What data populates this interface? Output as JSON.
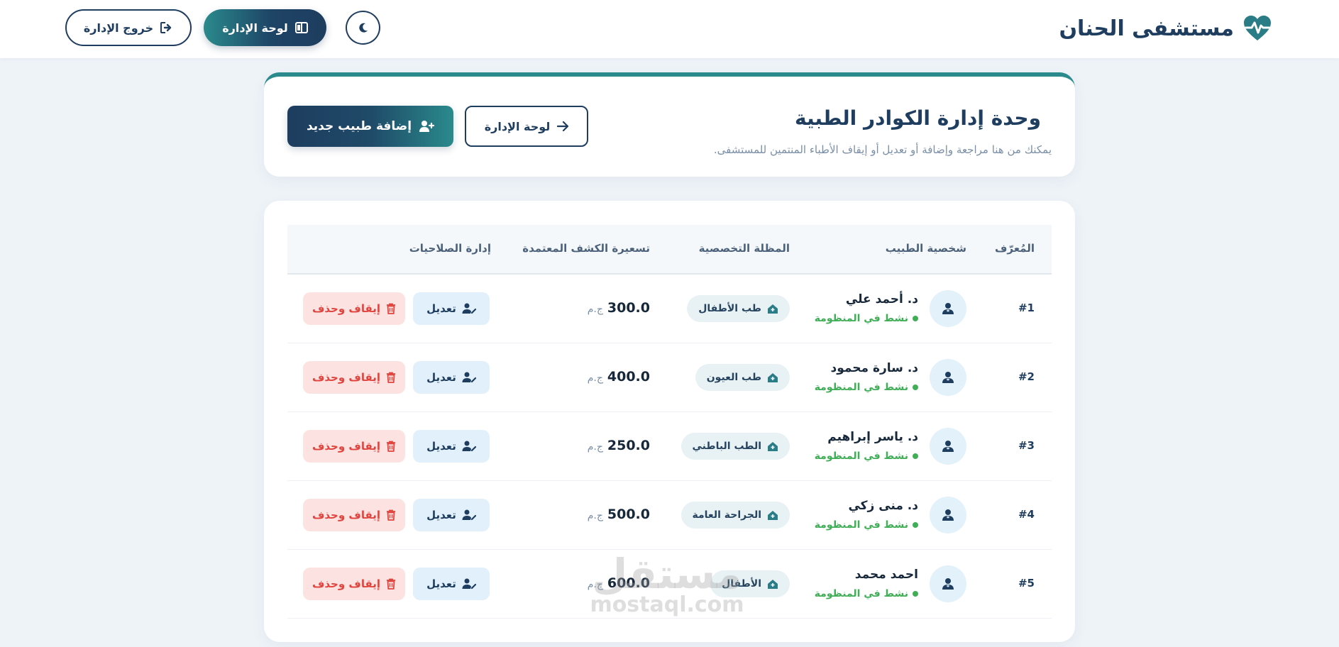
{
  "header": {
    "brand_title": "مستشفى الحنان",
    "logout_label": "خروج الإدارة",
    "dashboard_label": "لوحة الإدارة"
  },
  "title_card": {
    "title": "وحدة إدارة الكوادر الطبية",
    "subtitle": "يمكنك من هنا مراجعة وإضافة أو تعديل أو إيقاف الأطباء المنتمين للمستشفى.",
    "dashboard_label": "لوحة الإدارة",
    "add_label": "إضافة طبيب جديد"
  },
  "table": {
    "headers": {
      "id": "المُعرّف",
      "doctor": "شخصية الطبيب",
      "specialty": "المظلة التخصصية",
      "price": "تسعيرة الكشف المعتمدة",
      "actions": "إدارة الصلاحيات"
    },
    "edit_label": "تعديل",
    "delete_label": "إيقاف وحذف",
    "currency": "ج.م",
    "rows": [
      {
        "id": "#1",
        "name": "د. أحمد علي",
        "status": "نشط في المنظومة",
        "specialty": "طب الأطفال",
        "price": "300.0"
      },
      {
        "id": "#2",
        "name": "د. سارة محمود",
        "status": "نشط في المنظومة",
        "specialty": "طب العيون",
        "price": "400.0"
      },
      {
        "id": "#3",
        "name": "د. ياسر إبراهيم",
        "status": "نشط في المنظومة",
        "specialty": "الطب الباطني",
        "price": "250.0"
      },
      {
        "id": "#4",
        "name": "د. منى زكي",
        "status": "نشط في المنظومة",
        "specialty": "الجراحة العامة",
        "price": "500.0"
      },
      {
        "id": "#5",
        "name": "احمد محمد",
        "status": "نشط في المنظومة",
        "specialty": "الأطفال",
        "price": "600.0"
      }
    ]
  },
  "watermark": {
    "arabic": "مستقل",
    "latin": "mostaql.com"
  },
  "colors": {
    "primary": "#1e3d5f",
    "teal": "#2a8a8c",
    "success": "#3fae56",
    "danger": "#e0453f"
  }
}
